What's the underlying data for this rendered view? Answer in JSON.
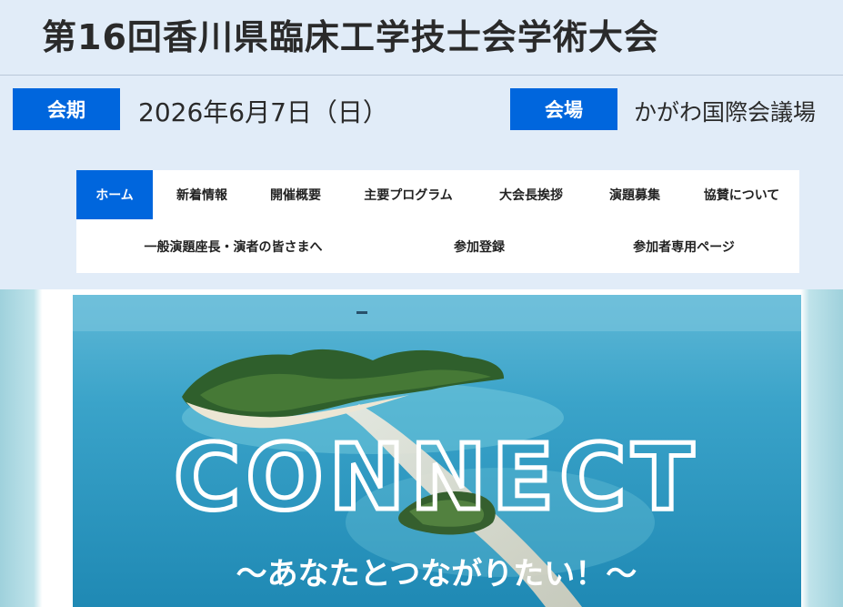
{
  "header": {
    "title": "第16回香川県臨床工学技士会学術大会",
    "term_label": "会期",
    "date": "2026年6月7日（日）",
    "venue_label": "会場",
    "venue": "かがわ国際会議場"
  },
  "nav": {
    "row1": [
      {
        "label": "ホーム",
        "active": true
      },
      {
        "label": "新着情報"
      },
      {
        "label": "開催概要"
      },
      {
        "label": "主要プログラム"
      },
      {
        "label": "大会長挨拶"
      },
      {
        "label": "演題募集"
      },
      {
        "label": "協賛について"
      }
    ],
    "row2": [
      {
        "label": "一般演題座長・演者の皆さまへ"
      },
      {
        "label": "参加登録"
      },
      {
        "label": "参加者専用ページ"
      }
    ]
  },
  "hero": {
    "headline": "CONNECT",
    "tagline": "〜あなたとつながりたい！〜"
  },
  "colors": {
    "accent": "#0066dd",
    "header_bg": "#e1ecf8",
    "sea": "#2a9fc8"
  }
}
